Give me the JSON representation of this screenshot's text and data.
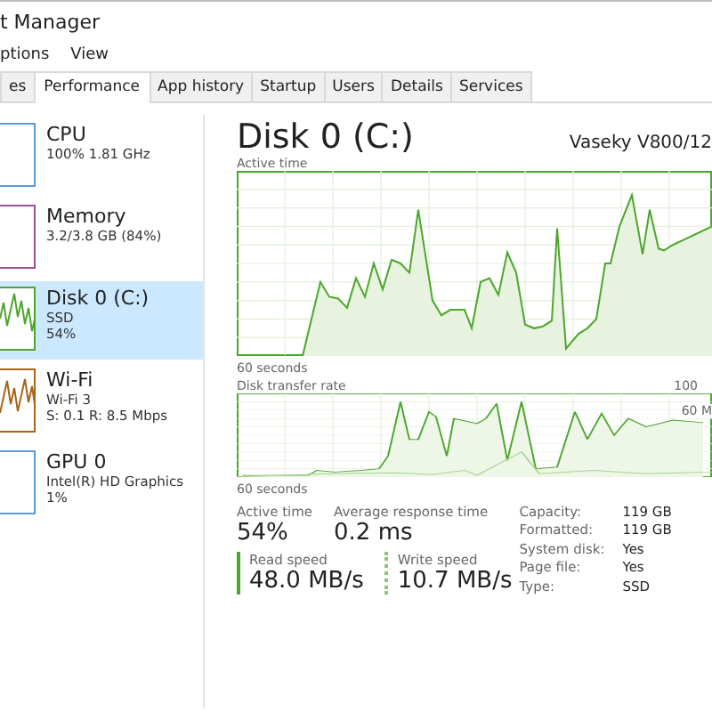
{
  "window": {
    "title": "t Manager"
  },
  "menu": [
    "ptions",
    "View"
  ],
  "tabs": [
    {
      "label": "es",
      "selected": false
    },
    {
      "label": "Performance",
      "selected": true
    },
    {
      "label": "App history",
      "selected": false
    },
    {
      "label": "Startup",
      "selected": false
    },
    {
      "label": "Users",
      "selected": false
    },
    {
      "label": "Details",
      "selected": false
    },
    {
      "label": "Services",
      "selected": false
    }
  ],
  "sidebar": {
    "items": [
      {
        "name": "CPU",
        "lines": [
          "100%  1.81 GHz"
        ],
        "selected": false,
        "color": "#5a9bd4"
      },
      {
        "name": "Memory",
        "lines": [
          "3.2/3.8 GB (84%)"
        ],
        "selected": false,
        "color": "#9b4f96"
      },
      {
        "name": "Disk 0 (C:)",
        "lines": [
          "SSD",
          "54%"
        ],
        "selected": true,
        "color": "#4da62d"
      },
      {
        "name": "Wi-Fi",
        "lines": [
          "Wi-Fi 3",
          "S: 0.1  R: 8.5 Mbps"
        ],
        "selected": false,
        "color": "#a7641a"
      },
      {
        "name": "GPU 0",
        "lines": [
          "Intel(R) HD Graphics",
          "1%"
        ],
        "selected": false,
        "color": "#5a9bd4"
      }
    ]
  },
  "main": {
    "title": "Disk 0 (C:)",
    "model": "Vaseky V800/12",
    "chart1": {
      "label": "Active time",
      "footer": "60 seconds"
    },
    "chart2": {
      "label": "Disk transfer rate",
      "max": "100",
      "mid": "60 M",
      "footer": "60 seconds"
    },
    "stats": [
      {
        "label": "Active time",
        "value": "54%"
      },
      {
        "label": "Average response time",
        "value": "0.2 ms"
      }
    ],
    "speeds": [
      {
        "label": "Read speed",
        "value": "48.0 MB/s",
        "kind": "solid"
      },
      {
        "label": "Write speed",
        "value": "10.7 MB/s",
        "kind": "dotted"
      }
    ],
    "properties": [
      {
        "label": "Capacity:",
        "value": "119 GB"
      },
      {
        "label": "Formatted:",
        "value": "119 GB"
      },
      {
        "label": "System disk:",
        "value": "Yes"
      },
      {
        "label": "Page file:",
        "value": "Yes"
      },
      {
        "label": "Type:",
        "value": "SSD"
      }
    ]
  }
}
